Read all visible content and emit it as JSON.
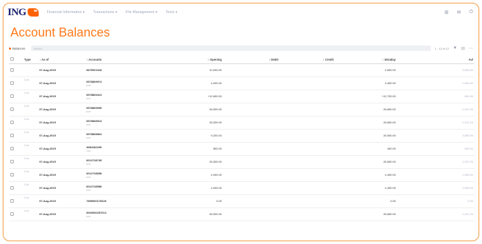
{
  "brand": {
    "logo_text": "ING",
    "accent": "#ff6200",
    "title_color": "#ff7a1a",
    "frame_color": "#f39a3d"
  },
  "nav": {
    "items": [
      "Financial Information ▾",
      "Transactions ▾",
      "File Management ▾",
      "Tools ▾"
    ]
  },
  "top_icons": {
    "grid": "⊞",
    "mail": "✉",
    "user": "⏻"
  },
  "page": {
    "title": "Account Balances"
  },
  "toolbar": {
    "tab_label": "Balances",
    "filter_placeholder": "Search",
    "pager": "1 - 12 of 12",
    "filter_icon": "▼",
    "export_icon": "⊟",
    "more_icon": "⋯"
  },
  "table": {
    "columns": [
      "Type",
      "↓ As of",
      "↕ Accounts",
      "↕ Opening",
      "↕ Debit",
      "↕ Credit",
      "↕ Intraday",
      "Avl"
    ],
    "rows": [
      {
        "type": "",
        "as_of": "07-Aug-2015",
        "account": "0875001918",
        "sub": "",
        "opening": "10,000.00",
        "debit": "",
        "credit": "",
        "intraday": "4,690.00",
        "avl": "2,000.00"
      },
      {
        "type": "Curr",
        "as_of": "07-Aug-2015",
        "account": "0578809974",
        "sub": "EUR",
        "opening": "4,000.00",
        "debit": "",
        "credit": "",
        "intraday": "4,490.00",
        "avl": "1,000.00"
      },
      {
        "type": "Curr",
        "as_of": "07-Aug-2015",
        "account": "0578809413",
        "sub": "EUR",
        "opening": "+12,600.00",
        "debit": "",
        "credit": "",
        "intraday": "+12,700.00",
        "avl": "600.00"
      },
      {
        "type": "Curr",
        "as_of": "07-Aug-2015",
        "account": "0578809095",
        "sub": "EUR",
        "opening": "26,530.00",
        "debit": "",
        "credit": "",
        "intraday": "26,650.00",
        "avl": "1,247.20"
      },
      {
        "type": "Curr",
        "as_of": "07-Aug-2015",
        "account": "0578808913",
        "sub": "EUR",
        "opening": "26,530.00",
        "debit": "",
        "credit": "",
        "intraday": "26,650.00",
        "avl": "1,212.16"
      },
      {
        "type": "Curr",
        "as_of": "07-Aug-2015",
        "account": "0578808804",
        "sub": "EUR",
        "opening": "9,200.00",
        "debit": "",
        "credit": "",
        "intraday": "26,900.00",
        "avl": "3,550.00"
      },
      {
        "type": "Curr",
        "as_of": "07-Aug-2015",
        "account": "4984182209",
        "sub": "USD",
        "opening": "800.00",
        "debit": "",
        "credit": "",
        "intraday": "400.00",
        "avl": "200.00"
      },
      {
        "type": "Curr",
        "as_of": "07-Aug-2015",
        "account": "6012728745",
        "sub": "EUR",
        "opening": "26,530.00",
        "debit": "",
        "credit": "",
        "intraday": "26,650.00",
        "avl": "1,247.20"
      },
      {
        "type": "Curr",
        "as_of": "07-Aug-2015",
        "account": "6012728658",
        "sub": "EUR",
        "opening": "4,000.00",
        "debit": "",
        "credit": "",
        "intraday": "4,490.00",
        "avl": "1,000.00"
      },
      {
        "type": "Curr",
        "as_of": "07-Aug-2015",
        "account": "6012728558",
        "sub": "EUR",
        "opening": "4,000.00",
        "debit": "",
        "credit": "",
        "intraday": "4,490.00",
        "avl": "1,000.00"
      },
      {
        "type": "Curr",
        "as_of": "07-Aug-2015",
        "account": "7895000176626",
        "sub": "",
        "opening": "0.00",
        "debit": "",
        "credit": "",
        "intraday": "0.00",
        "avl": "0.00"
      },
      {
        "type": "Curr",
        "as_of": "07-Aug-2015",
        "account": "0000000257013",
        "sub": "EUR",
        "opening": "26,530.00",
        "debit": "",
        "credit": "",
        "intraday": "26,650.00",
        "avl": "1,247.20"
      }
    ]
  }
}
